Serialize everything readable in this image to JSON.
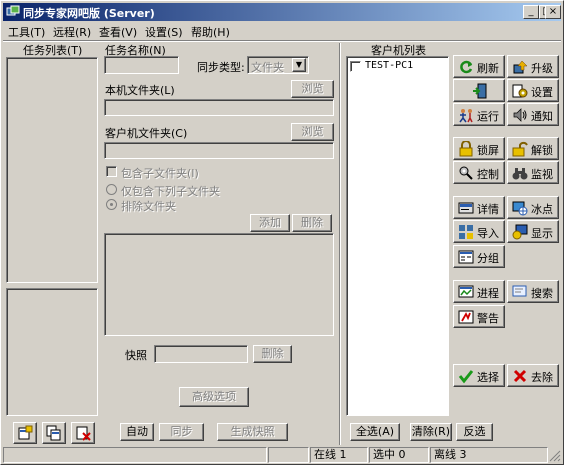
{
  "window": {
    "title": "同步专家网吧版 (Server)"
  },
  "menu": [
    "工具(T)",
    "远程(R)",
    "查看(V)",
    "设置(S)",
    "帮助(H)"
  ],
  "left": {
    "task_list_label": "任务列表(T)"
  },
  "form": {
    "task_name_label": "任务名称(N)",
    "sync_type_label": "同步类型:",
    "sync_type_value": "文件夹",
    "local_folder_label": "本机文件夹(L)",
    "client_folder_label": "客户机文件夹(C)",
    "browse": "浏览",
    "include_subfolders": "包含子文件夹(I)",
    "only_include": "仅包含下列子文件夹",
    "exclude_folders": "排除文件夹",
    "add": "添加",
    "delete": "删除",
    "snapshot_label": "快照",
    "snapshot_delete": "删除",
    "advanced": "高级选项"
  },
  "bottom_buttons": {
    "auto": "自动",
    "sync": "同步",
    "gen_snapshot": "生成快照"
  },
  "clients": {
    "label": "客户机列表",
    "items": [
      "TEST-PC1"
    ],
    "select_all": "全选(A)",
    "clear": "清除(R)",
    "invert": "反选"
  },
  "actions": {
    "refresh": "刷新",
    "upgrade": "升级",
    "run": "运行",
    "settings": "设置",
    "run2": "运行",
    "notify": "通知",
    "lock": "锁屏",
    "unlock": "解锁",
    "control": "控制",
    "monitor": "监视",
    "details": "详情",
    "freeze": "冰点",
    "import": "导入",
    "display": "显示",
    "group": "分组",
    "process": "进程",
    "search": "搜索",
    "alert": "警告",
    "select": "选择",
    "remove": "去除"
  },
  "status": {
    "online": "在线 1",
    "selected": "选中 0",
    "offline": "离线 3"
  }
}
